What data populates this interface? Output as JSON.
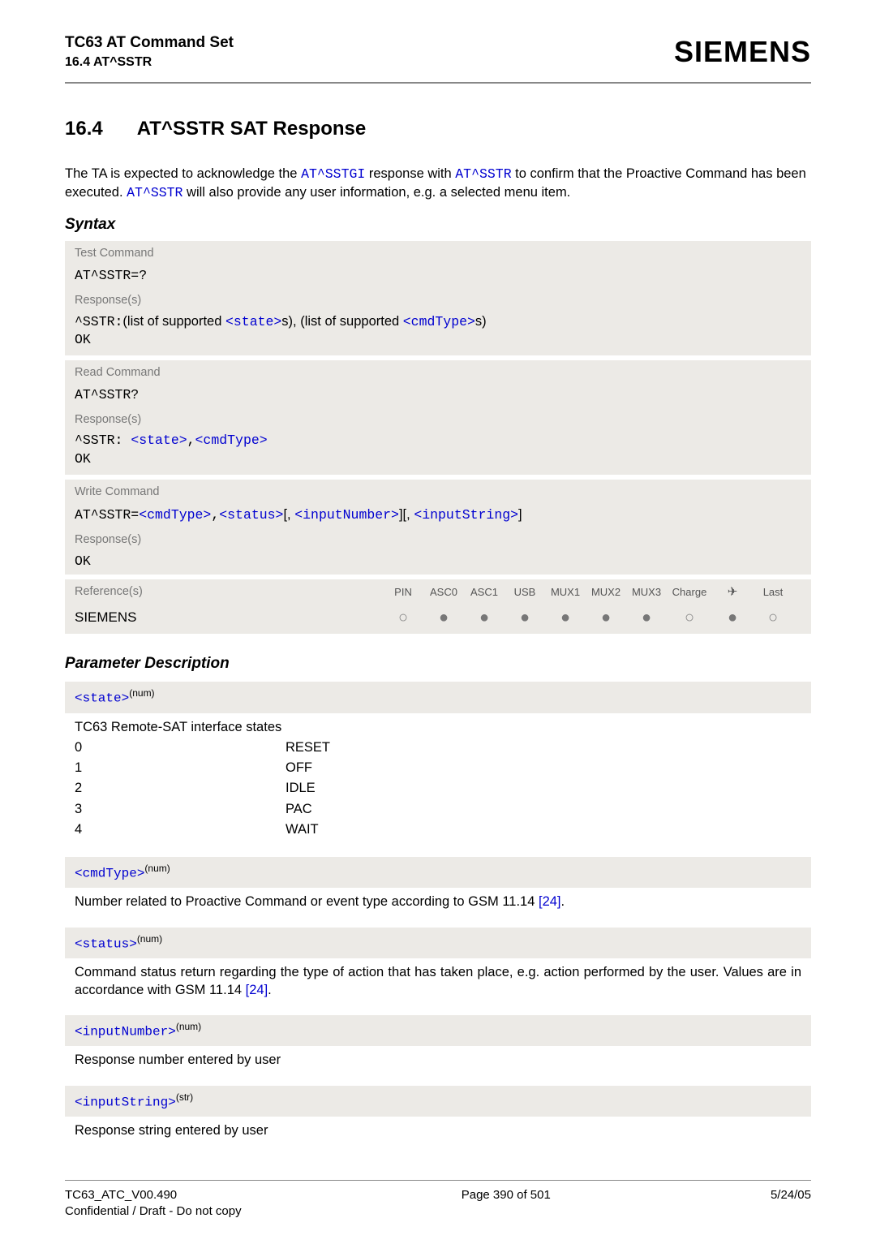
{
  "header": {
    "title": "TC63 AT Command Set",
    "subtitle": "16.4 AT^SSTR",
    "brand": "SIEMENS"
  },
  "section": {
    "number": "16.4",
    "title": "AT^SSTR   SAT Response"
  },
  "intro": {
    "t1": "The TA is expected to acknowledge the ",
    "l1": "AT^SSTGI",
    "t2": " response with ",
    "l2": "AT^SSTR",
    "t3": " to confirm that the Proactive Command has been executed. ",
    "l3": "AT^SSTR",
    "t4": " will also provide any user information, e.g. a selected menu item."
  },
  "syntax_label": "Syntax",
  "blocks": {
    "test": {
      "head": "Test Command",
      "cmd": "AT^SSTR=?",
      "resp_label": "Response(s)",
      "resp_prefix": "^SSTR:",
      "resp_t1": "(list of supported ",
      "resp_p1": "<state>",
      "resp_t2": "s), (list of supported ",
      "resp_p2": "<cmdType>",
      "resp_t3": "s)",
      "ok": "OK"
    },
    "read": {
      "head": "Read Command",
      "cmd": "AT^SSTR?",
      "resp_label": "Response(s)",
      "resp_prefix": "^SSTR: ",
      "p1": "<state>",
      "sep": ",",
      "p2": "<cmdType>",
      "ok": "OK"
    },
    "write": {
      "head": "Write Command",
      "cmd_prefix": "AT^SSTR=",
      "p1": "<cmdType>",
      "sep1": ",",
      "p2": "<status>",
      "br1": "[, ",
      "p3": "<inputNumber>",
      "br2": "][, ",
      "p4": "<inputString>",
      "br3": "]",
      "resp_label": "Response(s)",
      "ok": "OK"
    },
    "refs": {
      "label": "Reference(s)",
      "cols": [
        "PIN",
        "ASC0",
        "ASC1",
        "USB",
        "MUX1",
        "MUX2",
        "MUX3",
        "Charge",
        "✈",
        "Last"
      ],
      "siemens": "SIEMENS",
      "pattern": [
        "circ",
        "dot",
        "dot",
        "dot",
        "dot",
        "dot",
        "dot",
        "circ",
        "dot",
        "circ"
      ]
    }
  },
  "param_label": "Parameter Description",
  "params": {
    "state": {
      "name": "<state>",
      "sup": "(num)",
      "desc": "TC63 Remote-SAT interface states",
      "rows": [
        {
          "k": "0",
          "v": "RESET"
        },
        {
          "k": "1",
          "v": "OFF"
        },
        {
          "k": "2",
          "v": "IDLE"
        },
        {
          "k": "3",
          "v": "PAC"
        },
        {
          "k": "4",
          "v": "WAIT"
        }
      ]
    },
    "cmdType": {
      "name": "<cmdType>",
      "sup": "(num)",
      "desc_t1": "Number related to Proactive Command or event type according to GSM 11.14 ",
      "ref": "[24]",
      "desc_t2": "."
    },
    "status": {
      "name": "<status>",
      "sup": "(num)",
      "desc_t1": "Command status return regarding the type of action that has taken place, e.g. action performed by the user. Values are in accordance with GSM 11.14 ",
      "ref": "[24]",
      "desc_t2": "."
    },
    "inputNumber": {
      "name": "<inputNumber>",
      "sup": "(num)",
      "desc": "Response number entered by user"
    },
    "inputString": {
      "name": "<inputString>",
      "sup": "(str)",
      "desc": "Response string entered by user"
    }
  },
  "footer": {
    "left1": "TC63_ATC_V00.490",
    "left2": "Confidential / Draft - Do not copy",
    "center": "Page 390 of 501",
    "right": "5/24/05"
  }
}
